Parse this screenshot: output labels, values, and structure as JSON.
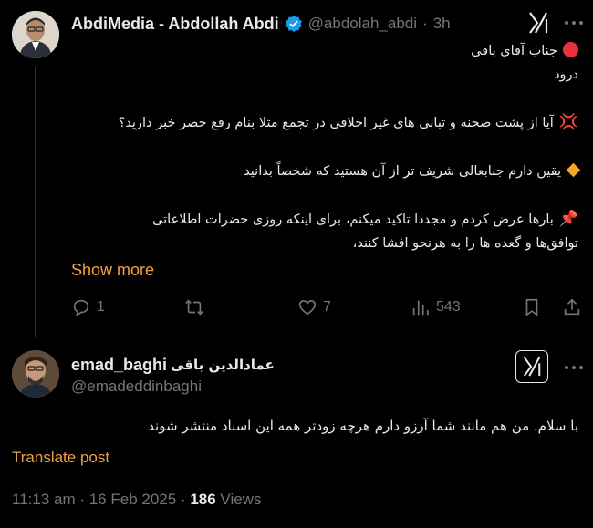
{
  "parent_tweet": {
    "author_name": "AbdiMedia - Abdollah Abdi",
    "handle": "@abdolah_abdi",
    "separator": "·",
    "time": "3h",
    "lines": [
      "جناب آقای باقی",
      "درود",
      "آیا از پشت صحنه و تبانی های غیر اخلاقی در تجمع مثلا بنام رفع حصر خبر دارید؟",
      "یقین دارم جنابعالی شریف تر از آن هستید که شخصاً بدانید",
      "بارها عرض کردم و مجددا تاکید میکنم، برای اینکه روزی حضرات اطلاعاتی",
      "توافق‌ها و گعده ها را به هرنحو افشا کنند،"
    ],
    "show_more": "Show more",
    "actions": {
      "replies": "1",
      "reposts": "",
      "likes": "7",
      "views": "543"
    }
  },
  "reply_tweet": {
    "author_name_latin": "emad_baghi",
    "author_name_persian": "عمادالدین باقی",
    "handle": "@emadeddinbaghi",
    "body": "با سلام. من هم مانند شما آرزو دارم هرچه زودتر همه این اسناد منتشر شوند",
    "translate": "Translate post",
    "timestamp": "11:13 am · 16 Feb 2025 · ",
    "views_count": "186",
    "views_label": " Views"
  },
  "colors": {
    "background": "#000000",
    "text": "#e7e9ea",
    "muted": "#71767b",
    "link": "#f0a040",
    "verified": "#1d9bf0"
  }
}
